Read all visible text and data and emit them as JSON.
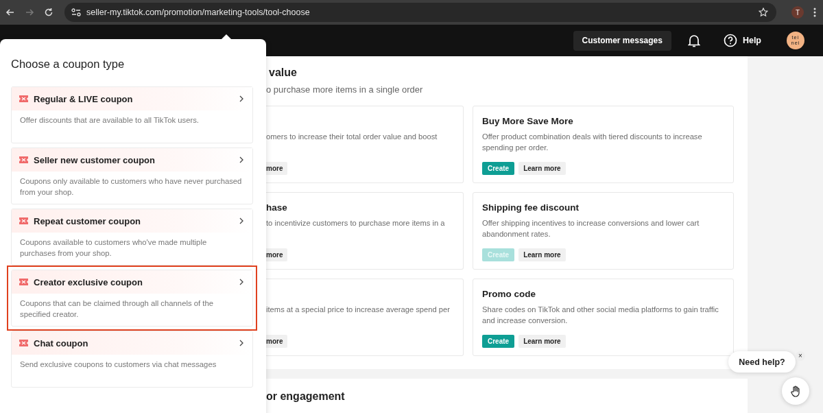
{
  "browser": {
    "url": "seller-my.tiktok.com/promotion/marketing-tools/tool-choose",
    "profile_initial": "T"
  },
  "header": {
    "messages_button": "Customer messages",
    "help": "Help",
    "avatar_lines": [
      "tei",
      "nei"
    ]
  },
  "section": {
    "title": "value",
    "subtitle": "o purchase more items in a single order"
  },
  "tool_rows": [
    {
      "cards": [
        {
          "description": "omers to increase their total order value and boost",
          "learn_more": "more",
          "cut": true
        },
        {
          "title": "Buy More Save More",
          "description": "Offer product combination deals with tiered discounts to increase spending per order.",
          "create": {
            "label": "Create",
            "disabled": false
          },
          "learn_more": "Learn more",
          "cut": false
        }
      ]
    },
    {
      "cards": [
        {
          "title": "hase",
          "description": "to incentivize customers to purchase more items in a",
          "learn_more": "more",
          "cut": true
        },
        {
          "title": "Shipping fee discount",
          "description": "Offer shipping incentives to increase conversions and lower cart abandonment rates.",
          "create": {
            "label": "Create",
            "disabled": true
          },
          "learn_more": "Learn more",
          "cut": false
        }
      ]
    },
    {
      "cards": [
        {
          "description": "items at a special price to increase average spend per",
          "learn_more": "more",
          "cut": true
        },
        {
          "title": "Promo code",
          "description": "Share codes on TikTok and other social media platforms to gain traffic and increase conversion.",
          "create": {
            "label": "Create",
            "disabled": false
          },
          "learn_more": "Learn more",
          "cut": false
        }
      ]
    }
  ],
  "next_section": {
    "title": "or engagement"
  },
  "coupon_popover": {
    "title": "Choose a coupon type",
    "items": [
      {
        "title": "Regular & LIVE coupon",
        "description": "Offer discounts that are available to all TikTok users.",
        "highlighted": false
      },
      {
        "title": "Seller new customer coupon",
        "description": "Coupons only available to customers who have never purchased from your shop.",
        "highlighted": false
      },
      {
        "title": "Repeat customer coupon",
        "description": "Coupons available to customers who've made multiple purchases from your shop.",
        "highlighted": false
      },
      {
        "title": "Creator exclusive coupon",
        "description": "Coupons that can be claimed through all channels of the specified creator.",
        "highlighted": true
      },
      {
        "title": "Chat coupon",
        "description": "Send exclusive coupons to customers via chat messages",
        "highlighted": false
      }
    ]
  },
  "help_bubble": {
    "text": "Need help?",
    "close": "×"
  }
}
